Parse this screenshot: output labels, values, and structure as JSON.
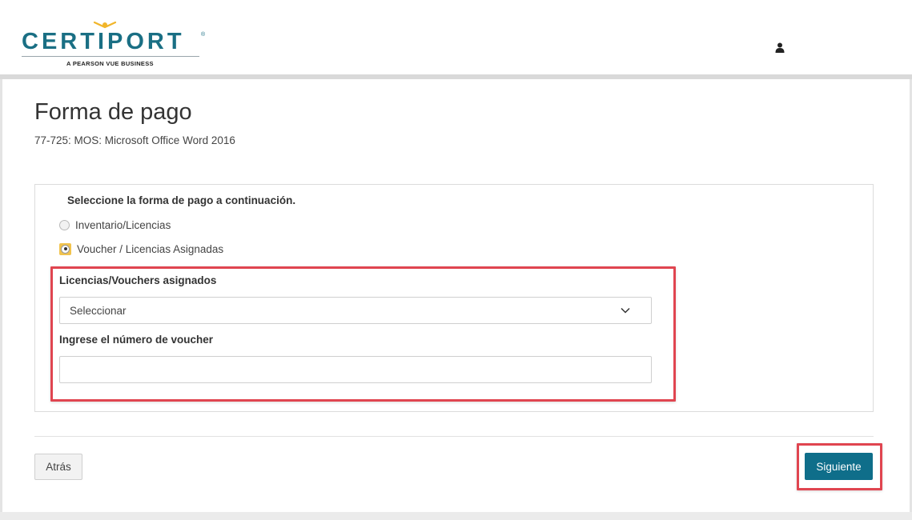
{
  "header": {
    "logo_text": "CERTIPORT",
    "logo_tagline": "A PEARSON VUE BUSINESS",
    "logo_registered": "®",
    "user_icon": "user-icon"
  },
  "page": {
    "title": "Forma de pago",
    "subtitle": "77-725: MOS: Microsoft Office Word 2016"
  },
  "payment": {
    "heading": "Seleccione la forma de pago a continuación.",
    "options": [
      {
        "label": "Inventario/Licencias",
        "selected": false
      },
      {
        "label": "Voucher / Licencias Asignadas",
        "selected": true
      }
    ],
    "assigned_label": "Licencias/Vouchers asignados",
    "assigned_select_value": "Seleccionar",
    "voucher_label": "Ingrese el número de voucher",
    "voucher_value": ""
  },
  "footer": {
    "back_label": "Atrás",
    "next_label": "Siguiente"
  },
  "colors": {
    "brand": "#1a6f84",
    "primary_button": "#0f6e8a",
    "highlight": "#e04550",
    "radio_selected": "#f1c34d"
  }
}
